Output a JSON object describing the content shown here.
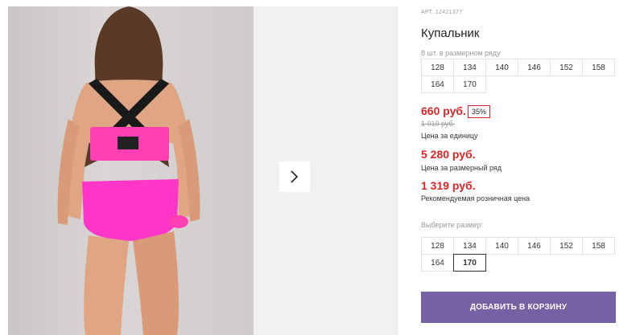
{
  "gallery": {
    "next_icon": "chevron-right-icon"
  },
  "product": {
    "article": "АРТ. 12421377",
    "title": "Купальник",
    "pack_hint": "8 шт. в размерном ряду",
    "pack_sizes": [
      "128",
      "134",
      "140",
      "146",
      "152",
      "158",
      "164",
      "170"
    ],
    "price": "660 руб.",
    "discount": "35%",
    "old_price": "1 010 руб.",
    "unit_price_label": "Цена за единицу",
    "pack_price": "5 280 руб.",
    "pack_price_label": "Цена за размерный ряд",
    "retail_price": "1 319 руб.",
    "retail_price_label": "Рекомендуемая розничная цена",
    "choose_size_label": "Выберите размер:",
    "sizes": [
      "128",
      "134",
      "140",
      "146",
      "152",
      "158",
      "164",
      "170"
    ],
    "selected_size": "170",
    "add_to_cart": "ДОБАВИТЬ В КОРЗИНУ"
  },
  "colors": {
    "accent": "#7462a4",
    "price_red": "#d62828",
    "swimsuit_pink": "#ff3fb3"
  }
}
